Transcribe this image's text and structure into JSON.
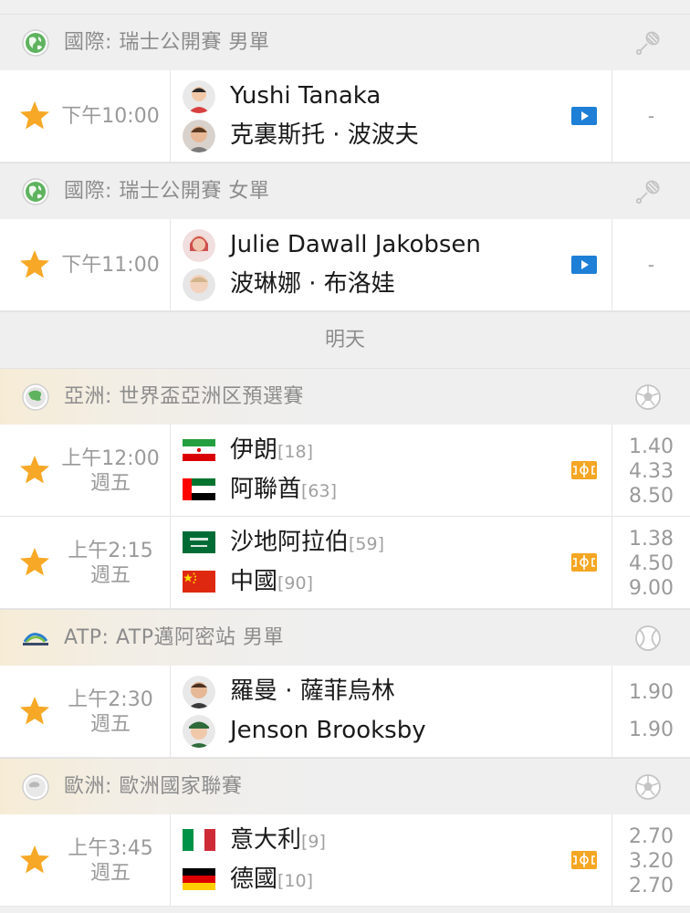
{
  "day_header": "明天",
  "groups": [
    {
      "league": "國際: 瑞士公開賽 男單",
      "sport_icon": "badminton-icon",
      "match": {
        "time": "下午10:00",
        "weekday": "",
        "home": {
          "name": "Yushi Tanaka",
          "rank": ""
        },
        "away": {
          "name": "克裏斯托 · 波波夫",
          "rank": ""
        },
        "media": "video",
        "odds": [
          "-"
        ]
      }
    },
    {
      "league": "國際: 瑞士公開賽 女單",
      "sport_icon": "badminton-icon",
      "match": {
        "time": "下午11:00",
        "weekday": "",
        "home": {
          "name": "Julie Dawall Jakobsen",
          "rank": ""
        },
        "away": {
          "name": "波琳娜 · 布洛娃",
          "rank": ""
        },
        "media": "video",
        "odds": [
          "-"
        ]
      }
    },
    {
      "league": "亞洲: 世界盃亞洲区預選賽",
      "sport_icon": "soccer-ball-icon",
      "matches": [
        {
          "time": "上午12:00",
          "weekday": "週五",
          "home": {
            "name": "伊朗",
            "rank": "[18]"
          },
          "away": {
            "name": "阿聯酋",
            "rank": "[63]"
          },
          "media": "pitch",
          "odds": [
            "1.40",
            "4.33",
            "8.50"
          ]
        },
        {
          "time": "上午2:15",
          "weekday": "週五",
          "home": {
            "name": "沙地阿拉伯",
            "rank": "[59]"
          },
          "away": {
            "name": "中國",
            "rank": "[90]"
          },
          "media": "pitch",
          "odds": [
            "1.38",
            "4.50",
            "9.00"
          ]
        }
      ]
    },
    {
      "league": "ATP: ATP邁阿密站 男單",
      "sport_icon": "tennis-ball-icon",
      "match": {
        "time": "上午2:30",
        "weekday": "週五",
        "home": {
          "name": "羅曼 · 薩菲烏林",
          "rank": ""
        },
        "away": {
          "name": "Jenson Brooksby",
          "rank": ""
        },
        "media": "",
        "odds": [
          "1.90",
          "1.90"
        ]
      }
    },
    {
      "league": "歐洲: 歐洲國家聯賽",
      "sport_icon": "soccer-ball-icon",
      "match": {
        "time": "上午3:45",
        "weekday": "週五",
        "home": {
          "name": "意大利",
          "rank": "[9]"
        },
        "away": {
          "name": "德國",
          "rank": "[10]"
        },
        "media": "pitch",
        "odds": [
          "2.70",
          "3.20",
          "2.70"
        ]
      }
    }
  ],
  "colors": {
    "star": "#f7a826",
    "video": "#1e7fd6",
    "pitch": "#f5a623",
    "text_muted": "#9a9a9a",
    "header_bg": "#efefef"
  }
}
